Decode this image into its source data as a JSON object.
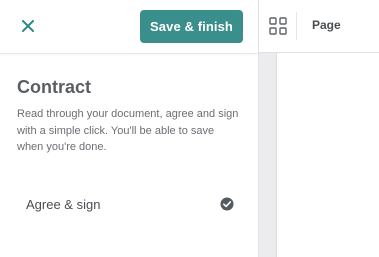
{
  "header": {
    "close_icon": "close-icon",
    "save_label": "Save & finish"
  },
  "contract": {
    "title": "Contract",
    "description": "Read through your document, agree and sign with a simple click. You'll be able to save when you're done."
  },
  "steps": [
    {
      "label": "Agree & sign",
      "icon": "check-circle-icon",
      "completed": true
    }
  ],
  "toolbar": {
    "grid_icon": "grid-icon",
    "page_label": "Page"
  },
  "colors": {
    "accent": "#3a8f8c",
    "close_icon": "#2f8a86",
    "check_icon": "#555a60"
  }
}
